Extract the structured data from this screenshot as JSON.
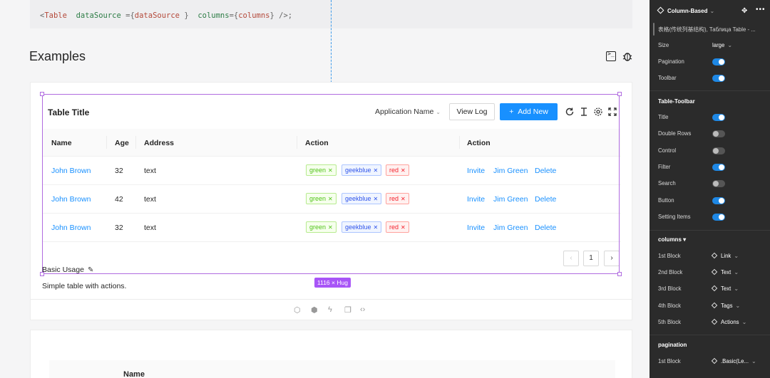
{
  "code": {
    "open": "<",
    "component": "Table",
    "attr1": "dataSource",
    "eq1": " ={",
    "val1": "dataSource",
    "close1": " }",
    "attr2": "columns",
    "eq2": "={",
    "val2": "columns",
    "close2": "}",
    "end": " />;"
  },
  "examples": {
    "title": "Examples",
    "icons": [
      "terminal-icon",
      "bug-icon"
    ]
  },
  "table": {
    "title": "Table Title",
    "app_select": "Application Name",
    "view_log": "View Log",
    "add_new": "Add New",
    "add_icon": "+",
    "toolbar_icons": [
      "reload-icon",
      "density-icon",
      "setting-icon",
      "fullscreen-icon"
    ],
    "columns": [
      "Name",
      "Age",
      "Address",
      "Action",
      "Action"
    ],
    "rows": [
      {
        "name": "John Brown",
        "age": "32",
        "address": "text",
        "tags": [
          "green",
          "geekblue",
          "red"
        ],
        "actions": [
          "Invite",
          "Jim Green",
          "Delete"
        ]
      },
      {
        "name": "John Brown",
        "age": "42",
        "address": "text",
        "tags": [
          "green",
          "geekblue",
          "red"
        ],
        "actions": [
          "Invite",
          "Jim Green",
          "Delete"
        ]
      },
      {
        "name": "John Brown",
        "age": "32",
        "address": "text",
        "tags": [
          "green",
          "geekblue",
          "red"
        ],
        "actions": [
          "Invite",
          "Jim Green",
          "Delete"
        ]
      }
    ],
    "pagination": {
      "prev": "‹",
      "page": "1",
      "next": "›"
    }
  },
  "selection": {
    "size_badge": "1116 × Hug",
    "color": "#a855f7"
  },
  "demo": {
    "title": "Basic Usage",
    "description": "Simple table with actions.",
    "actions": [
      "codesandbox-icon",
      "codepen-icon",
      "stackblitz-icon",
      "copy-icon",
      "code-icon"
    ]
  },
  "card2": {
    "header": "Name"
  },
  "panel": {
    "component": "Column-Based",
    "subtitle": "表格(传统列基结构), Таблица Table - ...",
    "size_label": "Size",
    "size_value": "large",
    "pagination_label": "Pagination",
    "pagination_on": true,
    "toolbar_label": "Toolbar",
    "toolbar_on": true,
    "table_toolbar_section": "Table-Toolbar",
    "table_toolbar_items": [
      {
        "label": "Title",
        "on": true
      },
      {
        "label": "Double Rows",
        "on": false
      },
      {
        "label": "Control",
        "on": false
      },
      {
        "label": "Filter",
        "on": true
      },
      {
        "label": "Search",
        "on": false
      },
      {
        "label": "Button",
        "on": true
      },
      {
        "label": "Setting Items",
        "on": true
      }
    ],
    "columns_section": "columns",
    "columns_items": [
      {
        "label": "1st Block",
        "value": "Link"
      },
      {
        "label": "2nd Block",
        "value": "Text"
      },
      {
        "label": "3rd Block",
        "value": "Text"
      },
      {
        "label": "4th Block",
        "value": "Tags"
      },
      {
        "label": "5th Block",
        "value": "Actions"
      }
    ],
    "pagination_section": "pagination",
    "pagination_items": [
      {
        "label": "1st Block",
        "value": ".Basic(Le..."
      }
    ],
    "accent": "#1e88e5"
  }
}
